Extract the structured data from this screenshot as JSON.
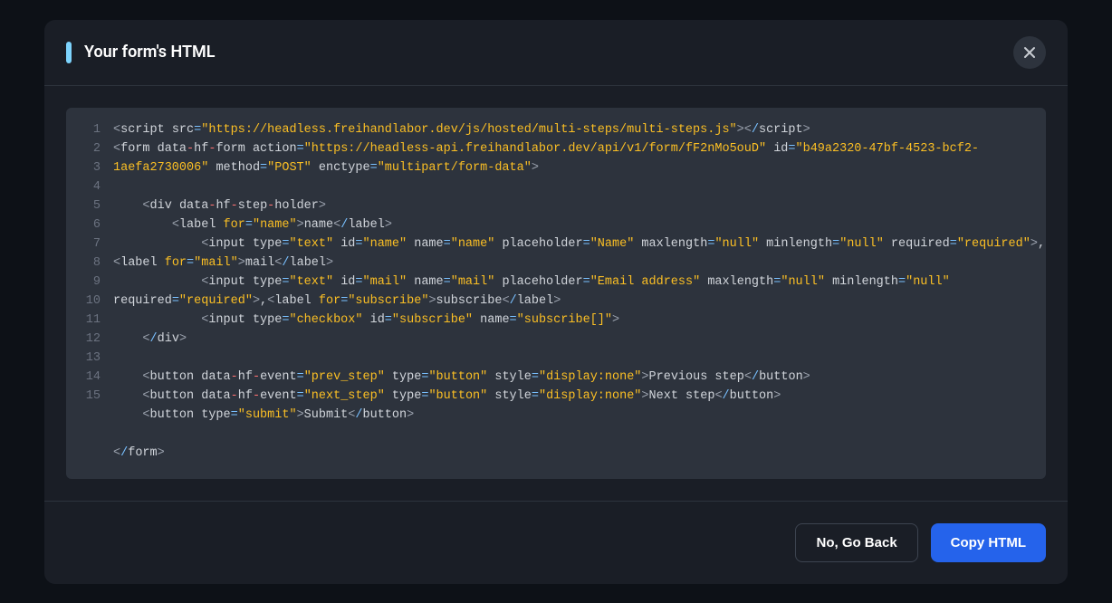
{
  "modal": {
    "title": "Your form's HTML"
  },
  "buttons": {
    "back": "No, Go Back",
    "copy": "Copy HTML"
  },
  "code": {
    "lines": [
      {
        "n": "1",
        "tokens": [
          {
            "c": "t-punct",
            "t": "<"
          },
          {
            "c": "t-tag",
            "t": "script"
          },
          {
            "c": "",
            "t": " "
          },
          {
            "c": "t-attr",
            "t": "src"
          },
          {
            "c": "t-op",
            "t": "="
          },
          {
            "c": "t-str",
            "t": "\"https://headless.freihandlabor.dev/js/hosted/multi-steps/multi-steps.js\""
          },
          {
            "c": "t-punct",
            "t": "><"
          },
          {
            "c": "t-op",
            "t": "/"
          },
          {
            "c": "t-tag",
            "t": "script"
          },
          {
            "c": "t-punct",
            "t": ">"
          }
        ]
      },
      {
        "n": "2",
        "tokens": [
          {
            "c": "t-punct",
            "t": "<"
          },
          {
            "c": "t-tag",
            "t": "form"
          },
          {
            "c": "",
            "t": " "
          },
          {
            "c": "t-attr",
            "t": "data"
          },
          {
            "c": "t-dash",
            "t": "-"
          },
          {
            "c": "t-attr",
            "t": "hf"
          },
          {
            "c": "t-dash",
            "t": "-"
          },
          {
            "c": "t-attr",
            "t": "form action"
          },
          {
            "c": "t-op",
            "t": "="
          },
          {
            "c": "t-str",
            "t": "\"https://headless-api.freihandlabor.dev/api/v1/form/fF2nMo5ouD\""
          },
          {
            "c": "",
            "t": " "
          },
          {
            "c": "t-attr",
            "t": "id"
          },
          {
            "c": "t-op",
            "t": "="
          },
          {
            "c": "t-str",
            "t": "\"b49a2320-47bf-4523-bcf2-"
          }
        ]
      },
      {
        "n": "3",
        "tokens": [
          {
            "c": "t-str",
            "t": "1aefa2730006\""
          },
          {
            "c": "",
            "t": " "
          },
          {
            "c": "t-attr",
            "t": "method"
          },
          {
            "c": "t-op",
            "t": "="
          },
          {
            "c": "t-str",
            "t": "\"POST\""
          },
          {
            "c": "",
            "t": " "
          },
          {
            "c": "t-attr",
            "t": "enctype"
          },
          {
            "c": "t-op",
            "t": "="
          },
          {
            "c": "t-str",
            "t": "\"multipart/form-data\""
          },
          {
            "c": "t-punct",
            "t": ">"
          }
        ]
      },
      {
        "n": "4",
        "tokens": []
      },
      {
        "n": "5",
        "tokens": [
          {
            "c": "",
            "t": "    "
          },
          {
            "c": "t-punct",
            "t": "<"
          },
          {
            "c": "t-tag",
            "t": "div"
          },
          {
            "c": "",
            "t": " "
          },
          {
            "c": "t-attr",
            "t": "data"
          },
          {
            "c": "t-dash",
            "t": "-"
          },
          {
            "c": "t-attr",
            "t": "hf"
          },
          {
            "c": "t-dash",
            "t": "-"
          },
          {
            "c": "t-attr",
            "t": "step"
          },
          {
            "c": "t-dash",
            "t": "-"
          },
          {
            "c": "t-attr",
            "t": "holder"
          },
          {
            "c": "t-punct",
            "t": ">"
          }
        ]
      },
      {
        "n": "6",
        "tokens": [
          {
            "c": "",
            "t": "        "
          },
          {
            "c": "t-punct",
            "t": "<"
          },
          {
            "c": "t-tag",
            "t": "label"
          },
          {
            "c": "",
            "t": " "
          },
          {
            "c": "t-for",
            "t": "for"
          },
          {
            "c": "t-op",
            "t": "="
          },
          {
            "c": "t-str",
            "t": "\"name\""
          },
          {
            "c": "t-punct",
            "t": ">"
          },
          {
            "c": "t-text",
            "t": "name"
          },
          {
            "c": "t-punct",
            "t": "<"
          },
          {
            "c": "t-op",
            "t": "/"
          },
          {
            "c": "t-tag",
            "t": "label"
          },
          {
            "c": "t-punct",
            "t": ">"
          }
        ]
      },
      {
        "n": "7",
        "tokens": [
          {
            "c": "",
            "t": "            "
          },
          {
            "c": "t-punct",
            "t": "<"
          },
          {
            "c": "t-tag",
            "t": "input"
          },
          {
            "c": "",
            "t": " "
          },
          {
            "c": "t-attr",
            "t": "type"
          },
          {
            "c": "t-op",
            "t": "="
          },
          {
            "c": "t-str",
            "t": "\"text\""
          },
          {
            "c": "",
            "t": " "
          },
          {
            "c": "t-attr",
            "t": "id"
          },
          {
            "c": "t-op",
            "t": "="
          },
          {
            "c": "t-str",
            "t": "\"name\""
          },
          {
            "c": "",
            "t": " "
          },
          {
            "c": "t-attr",
            "t": "name"
          },
          {
            "c": "t-op",
            "t": "="
          },
          {
            "c": "t-str",
            "t": "\"name\""
          },
          {
            "c": "",
            "t": " "
          },
          {
            "c": "t-attr",
            "t": "placeholder"
          },
          {
            "c": "t-op",
            "t": "="
          },
          {
            "c": "t-str",
            "t": "\"Name\""
          },
          {
            "c": "",
            "t": " "
          },
          {
            "c": "t-attr",
            "t": "maxlength"
          },
          {
            "c": "t-op",
            "t": "="
          },
          {
            "c": "t-str",
            "t": "\"null\""
          },
          {
            "c": "",
            "t": " "
          },
          {
            "c": "t-attr",
            "t": "minlength"
          },
          {
            "c": "t-op",
            "t": "="
          },
          {
            "c": "t-str",
            "t": "\"null\""
          },
          {
            "c": "",
            "t": " "
          },
          {
            "c": "t-attr",
            "t": "required"
          },
          {
            "c": "t-op",
            "t": "="
          },
          {
            "c": "t-str",
            "t": "\"required\""
          },
          {
            "c": "t-punct",
            "t": ">"
          },
          {
            "c": "t-text",
            "t": ","
          }
        ]
      },
      {
        "n": "8",
        "tokens": [
          {
            "c": "t-punct",
            "t": "<"
          },
          {
            "c": "t-tag",
            "t": "label"
          },
          {
            "c": "",
            "t": " "
          },
          {
            "c": "t-for",
            "t": "for"
          },
          {
            "c": "t-op",
            "t": "="
          },
          {
            "c": "t-str",
            "t": "\"mail\""
          },
          {
            "c": "t-punct",
            "t": ">"
          },
          {
            "c": "t-text",
            "t": "mail"
          },
          {
            "c": "t-punct",
            "t": "<"
          },
          {
            "c": "t-op",
            "t": "/"
          },
          {
            "c": "t-tag",
            "t": "label"
          },
          {
            "c": "t-punct",
            "t": ">"
          }
        ]
      },
      {
        "n": "9",
        "tokens": [
          {
            "c": "",
            "t": "            "
          },
          {
            "c": "t-punct",
            "t": "<"
          },
          {
            "c": "t-tag",
            "t": "input"
          },
          {
            "c": "",
            "t": " "
          },
          {
            "c": "t-attr",
            "t": "type"
          },
          {
            "c": "t-op",
            "t": "="
          },
          {
            "c": "t-str",
            "t": "\"text\""
          },
          {
            "c": "",
            "t": " "
          },
          {
            "c": "t-attr",
            "t": "id"
          },
          {
            "c": "t-op",
            "t": "="
          },
          {
            "c": "t-str",
            "t": "\"mail\""
          },
          {
            "c": "",
            "t": " "
          },
          {
            "c": "t-attr",
            "t": "name"
          },
          {
            "c": "t-op",
            "t": "="
          },
          {
            "c": "t-str",
            "t": "\"mail\""
          },
          {
            "c": "",
            "t": " "
          },
          {
            "c": "t-attr",
            "t": "placeholder"
          },
          {
            "c": "t-op",
            "t": "="
          },
          {
            "c": "t-str",
            "t": "\"Email address\""
          },
          {
            "c": "",
            "t": " "
          },
          {
            "c": "t-attr",
            "t": "maxlength"
          },
          {
            "c": "t-op",
            "t": "="
          },
          {
            "c": "t-str",
            "t": "\"null\""
          },
          {
            "c": "",
            "t": " "
          },
          {
            "c": "t-attr",
            "t": "minlength"
          },
          {
            "c": "t-op",
            "t": "="
          },
          {
            "c": "t-str",
            "t": "\"null\""
          }
        ]
      },
      {
        "n": "10",
        "tokens": [
          {
            "c": "t-attr",
            "t": "required"
          },
          {
            "c": "t-op",
            "t": "="
          },
          {
            "c": "t-str",
            "t": "\"required\""
          },
          {
            "c": "t-punct",
            "t": ">"
          },
          {
            "c": "t-text",
            "t": ","
          },
          {
            "c": "t-punct",
            "t": "<"
          },
          {
            "c": "t-tag",
            "t": "label"
          },
          {
            "c": "",
            "t": " "
          },
          {
            "c": "t-for",
            "t": "for"
          },
          {
            "c": "t-op",
            "t": "="
          },
          {
            "c": "t-str",
            "t": "\"subscribe\""
          },
          {
            "c": "t-punct",
            "t": ">"
          },
          {
            "c": "t-text",
            "t": "subscribe"
          },
          {
            "c": "t-punct",
            "t": "<"
          },
          {
            "c": "t-op",
            "t": "/"
          },
          {
            "c": "t-tag",
            "t": "label"
          },
          {
            "c": "t-punct",
            "t": ">"
          }
        ]
      },
      {
        "n": "11",
        "tokens": [
          {
            "c": "",
            "t": "            "
          },
          {
            "c": "t-punct",
            "t": "<"
          },
          {
            "c": "t-tag",
            "t": "input"
          },
          {
            "c": "",
            "t": " "
          },
          {
            "c": "t-attr",
            "t": "type"
          },
          {
            "c": "t-op",
            "t": "="
          },
          {
            "c": "t-str",
            "t": "\"checkbox\""
          },
          {
            "c": "",
            "t": " "
          },
          {
            "c": "t-attr",
            "t": "id"
          },
          {
            "c": "t-op",
            "t": "="
          },
          {
            "c": "t-str",
            "t": "\"subscribe\""
          },
          {
            "c": "",
            "t": " "
          },
          {
            "c": "t-attr",
            "t": "name"
          },
          {
            "c": "t-op",
            "t": "="
          },
          {
            "c": "t-str",
            "t": "\"subscribe[]\""
          },
          {
            "c": "t-punct",
            "t": ">"
          }
        ]
      },
      {
        "n": "12",
        "tokens": [
          {
            "c": "",
            "t": "    "
          },
          {
            "c": "t-punct",
            "t": "<"
          },
          {
            "c": "t-op",
            "t": "/"
          },
          {
            "c": "t-tag",
            "t": "div"
          },
          {
            "c": "t-punct",
            "t": ">"
          }
        ]
      },
      {
        "n": "13",
        "tokens": []
      },
      {
        "n": "14",
        "tokens": [
          {
            "c": "",
            "t": "    "
          },
          {
            "c": "t-punct",
            "t": "<"
          },
          {
            "c": "t-tag",
            "t": "button"
          },
          {
            "c": "",
            "t": " "
          },
          {
            "c": "t-attr",
            "t": "data"
          },
          {
            "c": "t-dash",
            "t": "-"
          },
          {
            "c": "t-attr",
            "t": "hf"
          },
          {
            "c": "t-dash",
            "t": "-"
          },
          {
            "c": "t-attr",
            "t": "event"
          },
          {
            "c": "t-op",
            "t": "="
          },
          {
            "c": "t-str",
            "t": "\"prev_step\""
          },
          {
            "c": "",
            "t": " "
          },
          {
            "c": "t-attr",
            "t": "type"
          },
          {
            "c": "t-op",
            "t": "="
          },
          {
            "c": "t-str",
            "t": "\"button\""
          },
          {
            "c": "",
            "t": " "
          },
          {
            "c": "t-attr",
            "t": "style"
          },
          {
            "c": "t-op",
            "t": "="
          },
          {
            "c": "t-str",
            "t": "\"display:none\""
          },
          {
            "c": "t-punct",
            "t": ">"
          },
          {
            "c": "t-text",
            "t": "Previous step"
          },
          {
            "c": "t-punct",
            "t": "<"
          },
          {
            "c": "t-op",
            "t": "/"
          },
          {
            "c": "t-tag",
            "t": "button"
          },
          {
            "c": "t-punct",
            "t": ">"
          }
        ]
      },
      {
        "n": "15",
        "tokens": [
          {
            "c": "",
            "t": "    "
          },
          {
            "c": "t-punct",
            "t": "<"
          },
          {
            "c": "t-tag",
            "t": "button"
          },
          {
            "c": "",
            "t": " "
          },
          {
            "c": "t-attr",
            "t": "data"
          },
          {
            "c": "t-dash",
            "t": "-"
          },
          {
            "c": "t-attr",
            "t": "hf"
          },
          {
            "c": "t-dash",
            "t": "-"
          },
          {
            "c": "t-attr",
            "t": "event"
          },
          {
            "c": "t-op",
            "t": "="
          },
          {
            "c": "t-str",
            "t": "\"next_step\""
          },
          {
            "c": "",
            "t": " "
          },
          {
            "c": "t-attr",
            "t": "type"
          },
          {
            "c": "t-op",
            "t": "="
          },
          {
            "c": "t-str",
            "t": "\"button\""
          },
          {
            "c": "",
            "t": " "
          },
          {
            "c": "t-attr",
            "t": "style"
          },
          {
            "c": "t-op",
            "t": "="
          },
          {
            "c": "t-str",
            "t": "\"display:none\""
          },
          {
            "c": "t-punct",
            "t": ">"
          },
          {
            "c": "t-text",
            "t": "Next step"
          },
          {
            "c": "t-punct",
            "t": "<"
          },
          {
            "c": "t-op",
            "t": "/"
          },
          {
            "c": "t-tag",
            "t": "button"
          },
          {
            "c": "t-punct",
            "t": ">"
          }
        ]
      },
      {
        "n": "",
        "tokens": [
          {
            "c": "",
            "t": "    "
          },
          {
            "c": "t-punct",
            "t": "<"
          },
          {
            "c": "t-tag",
            "t": "button"
          },
          {
            "c": "",
            "t": " "
          },
          {
            "c": "t-attr",
            "t": "type"
          },
          {
            "c": "t-op",
            "t": "="
          },
          {
            "c": "t-str",
            "t": "\"submit\""
          },
          {
            "c": "t-punct",
            "t": ">"
          },
          {
            "c": "t-text",
            "t": "Submit"
          },
          {
            "c": "t-punct",
            "t": "<"
          },
          {
            "c": "t-op",
            "t": "/"
          },
          {
            "c": "t-tag",
            "t": "button"
          },
          {
            "c": "t-punct",
            "t": ">"
          }
        ]
      },
      {
        "n": "",
        "tokens": []
      },
      {
        "n": "",
        "tokens": [
          {
            "c": "t-punct",
            "t": "<"
          },
          {
            "c": "t-op",
            "t": "/"
          },
          {
            "c": "t-tag",
            "t": "form"
          },
          {
            "c": "t-punct",
            "t": ">"
          }
        ]
      }
    ]
  }
}
